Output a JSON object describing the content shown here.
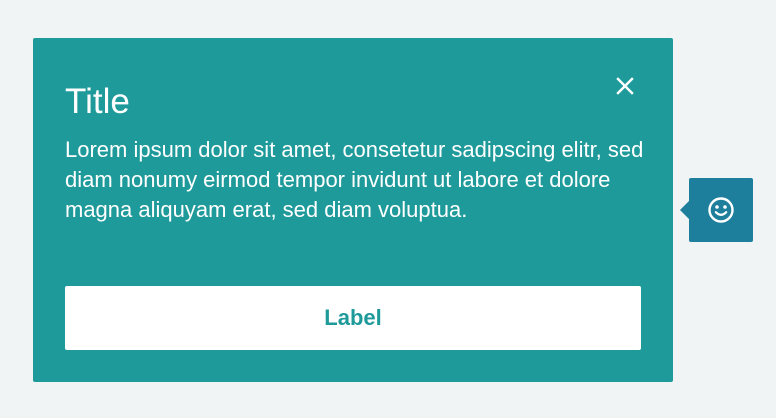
{
  "popover": {
    "title": "Title",
    "body": "Lorem ipsum dolor sit amet, consetetur sadipscing elitr, sed diam nonumy eirmod tempor invidunt ut labore et dolore magna aliquyam erat, sed diam voluptua.",
    "action_label": "Label",
    "close_icon": "close-icon",
    "background_color": "#1f9a9b",
    "text_color": "#ffffff"
  },
  "trigger": {
    "icon": "smiley-icon",
    "background_color": "#1d7f9c"
  },
  "page": {
    "background_color": "#f1f4f5"
  }
}
